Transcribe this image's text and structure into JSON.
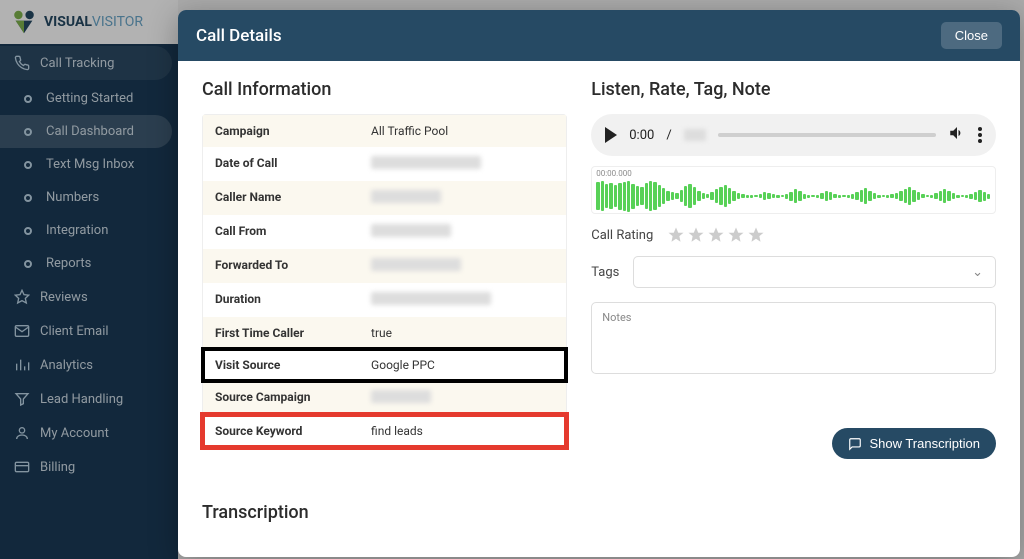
{
  "brand": {
    "primary": "VISUAL",
    "secondary": "VISITOR"
  },
  "sidebar": {
    "parent": "Call Tracking",
    "subs": [
      "Getting Started",
      "Call Dashboard",
      "Text Msg Inbox",
      "Numbers",
      "Integration",
      "Reports"
    ],
    "active_sub_index": 1,
    "rest": [
      "Reviews",
      "Client Email",
      "Analytics",
      "Lead Handling",
      "My Account",
      "Billing"
    ]
  },
  "modal": {
    "title": "Call Details",
    "close": "Close",
    "left_heading": "Call Information",
    "right_heading": "Listen, Rate, Tag, Note",
    "rows": [
      {
        "label": "Campaign",
        "value": "All Traffic Pool",
        "redacted_w": 0
      },
      {
        "label": "Date of Call",
        "value": "",
        "redacted_w": 110
      },
      {
        "label": "Caller Name",
        "value": "",
        "redacted_w": 70
      },
      {
        "label": "Call From",
        "value": "",
        "redacted_w": 80
      },
      {
        "label": "Forwarded To",
        "value": "",
        "redacted_w": 90
      },
      {
        "label": "Duration",
        "value": "",
        "redacted_w": 120
      },
      {
        "label": "First Time Caller",
        "value": "true",
        "redacted_w": 0
      },
      {
        "label": "Visit Source",
        "value": "Google PPC",
        "redacted_w": 0,
        "highlight": "black"
      },
      {
        "label": "Source Campaign",
        "value": "",
        "redacted_w": 60
      },
      {
        "label": "Source Keyword",
        "value": "find leads",
        "redacted_w": 0,
        "highlight": "red"
      }
    ],
    "audio": {
      "current": "0:00",
      "separator": "/",
      "waveform_timecode": "00:00.000"
    },
    "rating_label": "Call Rating",
    "tags_label": "Tags",
    "notes_placeholder": "Notes",
    "transcription_heading": "Transcription",
    "show_transcription": "Show Transcription"
  }
}
